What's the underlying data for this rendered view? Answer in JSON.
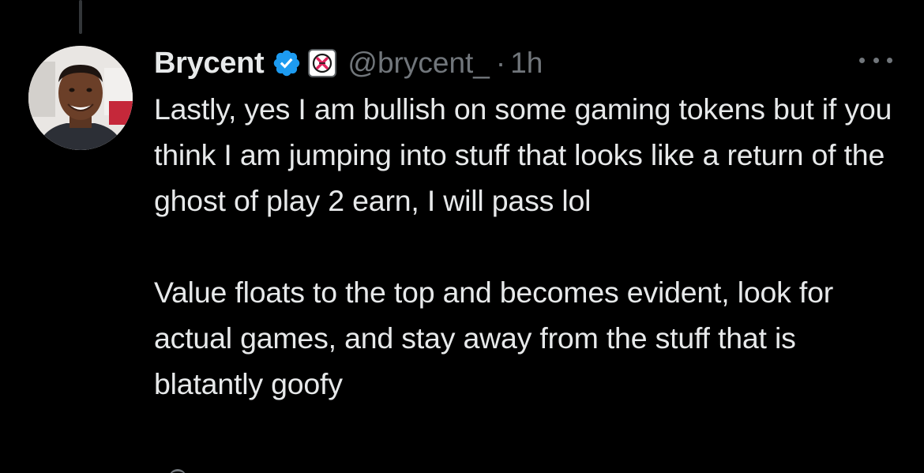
{
  "tweet": {
    "author": {
      "display_name": "Brycent",
      "handle": "@brycent_",
      "verified": true,
      "affiliate_badge_icon": "affiliate-logo-icon",
      "avatar_icon": "profile-photo"
    },
    "separator": "·",
    "time": "1h",
    "more_icon": "more-options-icon",
    "paragraphs": [
      "Lastly, yes I am bullish on some gaming tokens but if you think I am jumping into stuff that looks like a return of the ghost of play 2 earn, I will pass lol",
      "Value floats to the top and becomes evident, look for actual games, and stay away from the stuff that is blatantly goofy"
    ]
  },
  "colors": {
    "background": "#000000",
    "text_primary": "#e7e9ea",
    "text_secondary": "#71767b",
    "verified_blue": "#1d9bf0",
    "affiliate_red": "#e0245e"
  }
}
